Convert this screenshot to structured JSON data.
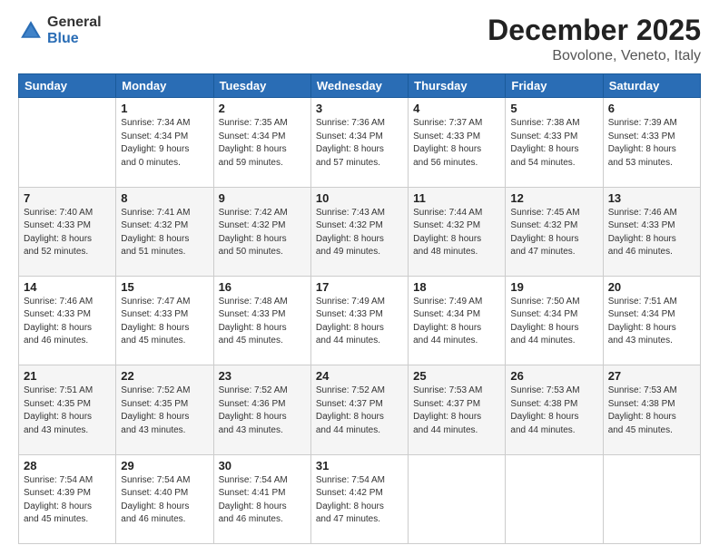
{
  "logo": {
    "general": "General",
    "blue": "Blue"
  },
  "header": {
    "month": "December 2025",
    "location": "Bovolone, Veneto, Italy"
  },
  "weekdays": [
    "Sunday",
    "Monday",
    "Tuesday",
    "Wednesday",
    "Thursday",
    "Friday",
    "Saturday"
  ],
  "weeks": [
    [
      {
        "day": "",
        "sunrise": "",
        "sunset": "",
        "daylight": ""
      },
      {
        "day": "1",
        "sunrise": "Sunrise: 7:34 AM",
        "sunset": "Sunset: 4:34 PM",
        "daylight": "Daylight: 9 hours and 0 minutes."
      },
      {
        "day": "2",
        "sunrise": "Sunrise: 7:35 AM",
        "sunset": "Sunset: 4:34 PM",
        "daylight": "Daylight: 8 hours and 59 minutes."
      },
      {
        "day": "3",
        "sunrise": "Sunrise: 7:36 AM",
        "sunset": "Sunset: 4:34 PM",
        "daylight": "Daylight: 8 hours and 57 minutes."
      },
      {
        "day": "4",
        "sunrise": "Sunrise: 7:37 AM",
        "sunset": "Sunset: 4:33 PM",
        "daylight": "Daylight: 8 hours and 56 minutes."
      },
      {
        "day": "5",
        "sunrise": "Sunrise: 7:38 AM",
        "sunset": "Sunset: 4:33 PM",
        "daylight": "Daylight: 8 hours and 54 minutes."
      },
      {
        "day": "6",
        "sunrise": "Sunrise: 7:39 AM",
        "sunset": "Sunset: 4:33 PM",
        "daylight": "Daylight: 8 hours and 53 minutes."
      }
    ],
    [
      {
        "day": "7",
        "sunrise": "Sunrise: 7:40 AM",
        "sunset": "Sunset: 4:33 PM",
        "daylight": "Daylight: 8 hours and 52 minutes."
      },
      {
        "day": "8",
        "sunrise": "Sunrise: 7:41 AM",
        "sunset": "Sunset: 4:32 PM",
        "daylight": "Daylight: 8 hours and 51 minutes."
      },
      {
        "day": "9",
        "sunrise": "Sunrise: 7:42 AM",
        "sunset": "Sunset: 4:32 PM",
        "daylight": "Daylight: 8 hours and 50 minutes."
      },
      {
        "day": "10",
        "sunrise": "Sunrise: 7:43 AM",
        "sunset": "Sunset: 4:32 PM",
        "daylight": "Daylight: 8 hours and 49 minutes."
      },
      {
        "day": "11",
        "sunrise": "Sunrise: 7:44 AM",
        "sunset": "Sunset: 4:32 PM",
        "daylight": "Daylight: 8 hours and 48 minutes."
      },
      {
        "day": "12",
        "sunrise": "Sunrise: 7:45 AM",
        "sunset": "Sunset: 4:32 PM",
        "daylight": "Daylight: 8 hours and 47 minutes."
      },
      {
        "day": "13",
        "sunrise": "Sunrise: 7:46 AM",
        "sunset": "Sunset: 4:33 PM",
        "daylight": "Daylight: 8 hours and 46 minutes."
      }
    ],
    [
      {
        "day": "14",
        "sunrise": "Sunrise: 7:46 AM",
        "sunset": "Sunset: 4:33 PM",
        "daylight": "Daylight: 8 hours and 46 minutes."
      },
      {
        "day": "15",
        "sunrise": "Sunrise: 7:47 AM",
        "sunset": "Sunset: 4:33 PM",
        "daylight": "Daylight: 8 hours and 45 minutes."
      },
      {
        "day": "16",
        "sunrise": "Sunrise: 7:48 AM",
        "sunset": "Sunset: 4:33 PM",
        "daylight": "Daylight: 8 hours and 45 minutes."
      },
      {
        "day": "17",
        "sunrise": "Sunrise: 7:49 AM",
        "sunset": "Sunset: 4:33 PM",
        "daylight": "Daylight: 8 hours and 44 minutes."
      },
      {
        "day": "18",
        "sunrise": "Sunrise: 7:49 AM",
        "sunset": "Sunset: 4:34 PM",
        "daylight": "Daylight: 8 hours and 44 minutes."
      },
      {
        "day": "19",
        "sunrise": "Sunrise: 7:50 AM",
        "sunset": "Sunset: 4:34 PM",
        "daylight": "Daylight: 8 hours and 44 minutes."
      },
      {
        "day": "20",
        "sunrise": "Sunrise: 7:51 AM",
        "sunset": "Sunset: 4:34 PM",
        "daylight": "Daylight: 8 hours and 43 minutes."
      }
    ],
    [
      {
        "day": "21",
        "sunrise": "Sunrise: 7:51 AM",
        "sunset": "Sunset: 4:35 PM",
        "daylight": "Daylight: 8 hours and 43 minutes."
      },
      {
        "day": "22",
        "sunrise": "Sunrise: 7:52 AM",
        "sunset": "Sunset: 4:35 PM",
        "daylight": "Daylight: 8 hours and 43 minutes."
      },
      {
        "day": "23",
        "sunrise": "Sunrise: 7:52 AM",
        "sunset": "Sunset: 4:36 PM",
        "daylight": "Daylight: 8 hours and 43 minutes."
      },
      {
        "day": "24",
        "sunrise": "Sunrise: 7:52 AM",
        "sunset": "Sunset: 4:37 PM",
        "daylight": "Daylight: 8 hours and 44 minutes."
      },
      {
        "day": "25",
        "sunrise": "Sunrise: 7:53 AM",
        "sunset": "Sunset: 4:37 PM",
        "daylight": "Daylight: 8 hours and 44 minutes."
      },
      {
        "day": "26",
        "sunrise": "Sunrise: 7:53 AM",
        "sunset": "Sunset: 4:38 PM",
        "daylight": "Daylight: 8 hours and 44 minutes."
      },
      {
        "day": "27",
        "sunrise": "Sunrise: 7:53 AM",
        "sunset": "Sunset: 4:38 PM",
        "daylight": "Daylight: 8 hours and 45 minutes."
      }
    ],
    [
      {
        "day": "28",
        "sunrise": "Sunrise: 7:54 AM",
        "sunset": "Sunset: 4:39 PM",
        "daylight": "Daylight: 8 hours and 45 minutes."
      },
      {
        "day": "29",
        "sunrise": "Sunrise: 7:54 AM",
        "sunset": "Sunset: 4:40 PM",
        "daylight": "Daylight: 8 hours and 46 minutes."
      },
      {
        "day": "30",
        "sunrise": "Sunrise: 7:54 AM",
        "sunset": "Sunset: 4:41 PM",
        "daylight": "Daylight: 8 hours and 46 minutes."
      },
      {
        "day": "31",
        "sunrise": "Sunrise: 7:54 AM",
        "sunset": "Sunset: 4:42 PM",
        "daylight": "Daylight: 8 hours and 47 minutes."
      },
      {
        "day": "",
        "sunrise": "",
        "sunset": "",
        "daylight": ""
      },
      {
        "day": "",
        "sunrise": "",
        "sunset": "",
        "daylight": ""
      },
      {
        "day": "",
        "sunrise": "",
        "sunset": "",
        "daylight": ""
      }
    ]
  ]
}
